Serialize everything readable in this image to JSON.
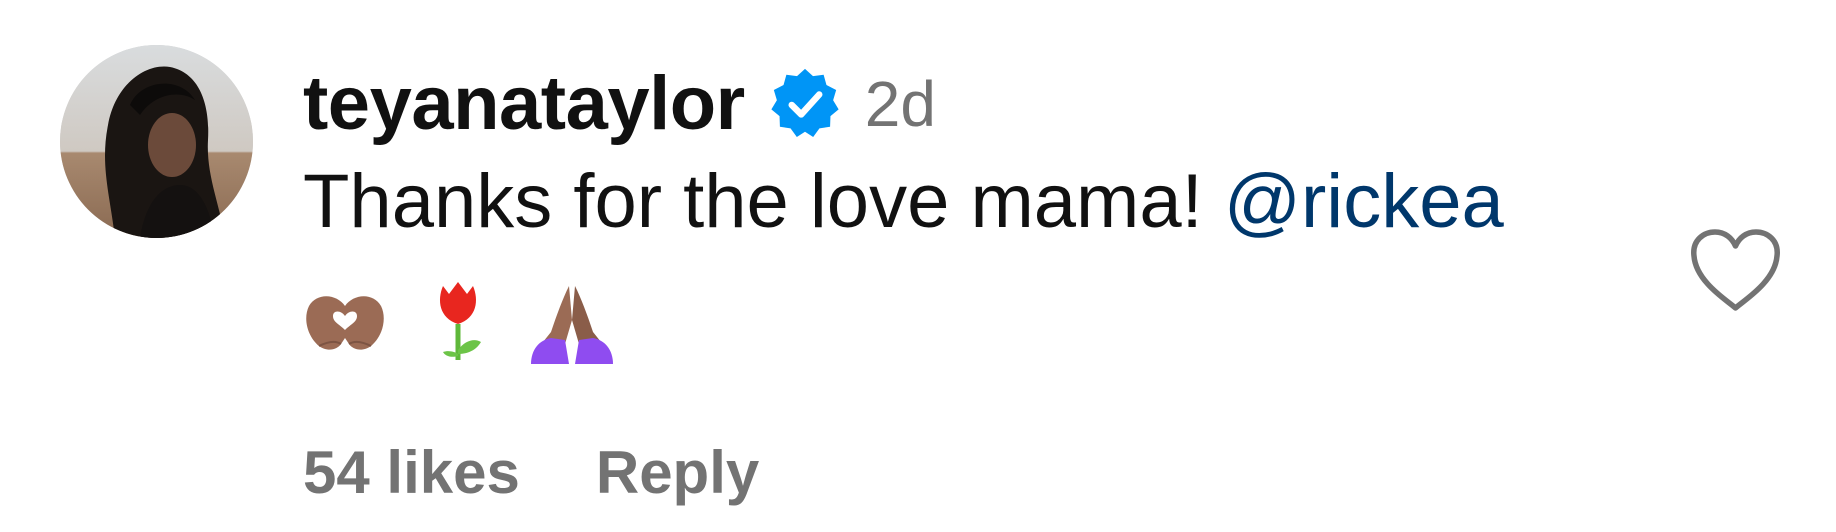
{
  "comment": {
    "username": "teyanataylor",
    "verified": true,
    "timestamp": "2d",
    "text": "Thanks for the love mama! ",
    "mention": "@rickea",
    "emojis": [
      "heart-hands-emoji",
      "tulip-emoji",
      "folded-hands-emoji"
    ],
    "likes_label": "54 likes",
    "reply_label": "Reply"
  },
  "colors": {
    "text": "#111111",
    "secondary": "#737373",
    "mention": "#00376b",
    "verified_badge": "#0095f6"
  }
}
